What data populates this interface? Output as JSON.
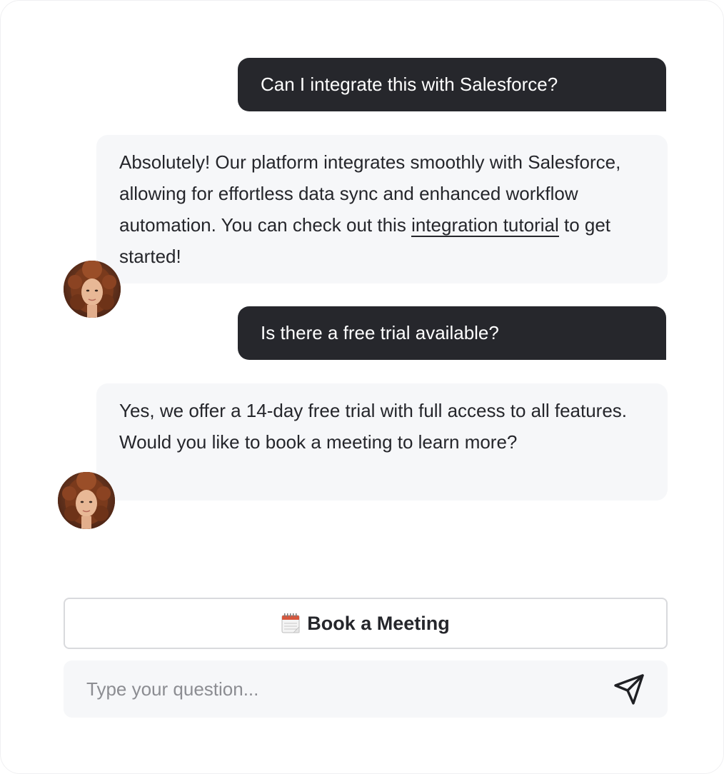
{
  "conversation": {
    "messages": [
      {
        "role": "user",
        "text": "Can I integrate this with Salesforce?"
      },
      {
        "role": "assistant",
        "text_before_link": "Absolutely! Our platform integrates smoothly with Salesforce, allowing for effortless data sync and enhanced workflow automation. You can check out this ",
        "link_text": "integration tutorial",
        "text_after_link": " to get started!",
        "avatar_icon": "assistant-avatar"
      },
      {
        "role": "user",
        "text": "Is there a free trial available?"
      },
      {
        "role": "assistant",
        "text": "Yes, we offer a 14-day free trial with full access to all features. Would you like to book a meeting to learn more?",
        "avatar_icon": "assistant-avatar"
      }
    ]
  },
  "actions": {
    "book_meeting": {
      "icon": "calendar-icon",
      "label": "Book a Meeting"
    }
  },
  "composer": {
    "placeholder": "Type your question...",
    "value": "",
    "send_icon": "send-icon"
  },
  "colors": {
    "user_bubble": "#26272c",
    "assistant_bubble": "#f6f7f9",
    "text": "#25262b",
    "placeholder": "#8c8d92",
    "button_border": "#d9dadd"
  }
}
